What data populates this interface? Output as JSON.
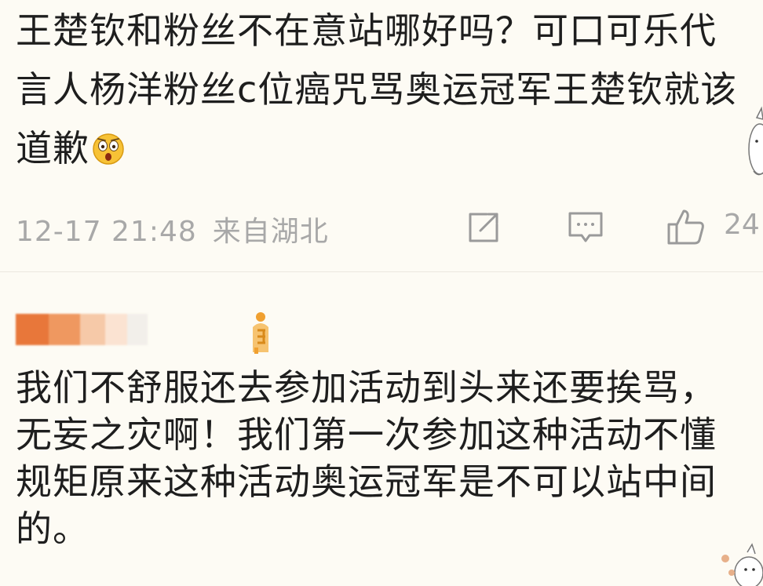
{
  "post": {
    "text": "王楚钦和粉丝不在意站哪好吗？可口可乐代言人杨洋粉丝c位癌咒骂奥运冠军王楚钦就该道歉",
    "emoji": "shocked-emoji",
    "timestamp": "12-17 21:48",
    "location": "来自湖北",
    "like_count": "24"
  },
  "reply": {
    "text": "我们不舒服还去参加活动到头来还要挨骂，无妄之灾啊！我们第一次参加这种活动不懂规矩原来这种活动奥运冠军是不可以站中间的。"
  },
  "icons": {
    "share": "share-icon",
    "comment": "comment-icon",
    "like": "thumbs-up-icon",
    "badge": "fan-badge-icon"
  },
  "colors": {
    "background": "#fdfbf4",
    "text": "#1e1e1e",
    "meta": "#a8a8a8",
    "badge": "#f0a030",
    "name_blur": [
      "#e8773a",
      "#ef9860",
      "#f6c9a8",
      "#fbe3d2",
      "#f2efea"
    ]
  }
}
